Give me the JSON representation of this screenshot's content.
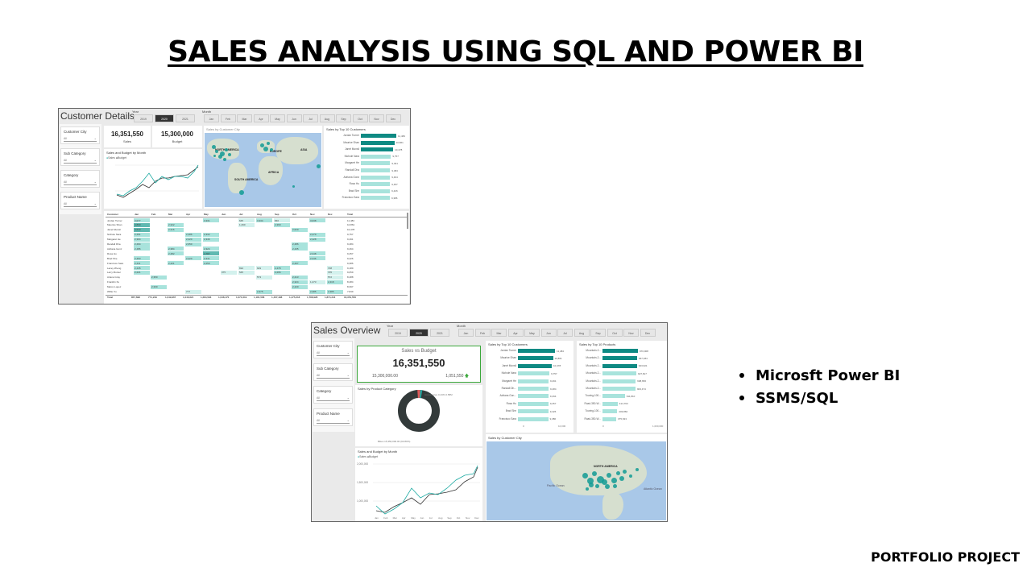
{
  "title": "SALES ANALYSIS USING SQL AND POWER BI",
  "bullets": [
    "Microsft Power BI",
    "SSMS/SQL"
  ],
  "footer": "PORTFOLIO PROJECT",
  "colors": {
    "teal_dark": "#0e8a83",
    "teal_light": "#a8e3dc",
    "kpi_border": "#3ca83c",
    "selected": "#333333"
  },
  "customer_details": {
    "title": "Customer Details",
    "year_label": "Year",
    "years": [
      "2019",
      "2020",
      "2021"
    ],
    "selected_year": "2020",
    "month_label": "Month",
    "months": [
      "Jan",
      "Feb",
      "Mar",
      "Apr",
      "May",
      "Jun",
      "Jul",
      "Aug",
      "Sep",
      "Oct",
      "Nov",
      "Dec"
    ],
    "filters": [
      {
        "label": "Customer City",
        "value": "All"
      },
      {
        "label": "Sub Category",
        "value": "All"
      },
      {
        "label": "Category",
        "value": "All"
      },
      {
        "label": "Product Name",
        "value": "All"
      }
    ],
    "kpis": [
      {
        "value": "16,351,550",
        "label": "Sales"
      },
      {
        "value": "15,300,000",
        "label": "Budget"
      }
    ],
    "line_title": "Sales and Budget by Month",
    "legend": [
      "Sales",
      "Budget"
    ],
    "map_title": "Sales by Customer City",
    "map_labels": [
      "NORTH AMERICA",
      "EUROPE",
      "ASIA",
      "AFRICA",
      "SOUTH AMERICA"
    ],
    "top10_title": "Sales by Top 10 Customers",
    "top10": [
      {
        "name": "Jordan Turner",
        "value": "11,484"
      },
      {
        "name": "Maurice Shan",
        "value": "10,861"
      },
      {
        "name": "Janet Munsil",
        "value": "10,478"
      },
      {
        "name": "Nichole Nara",
        "value": "9,757"
      },
      {
        "name": "Margaret He",
        "value": "9,491"
      },
      {
        "name": "Randall Dha",
        "value": "9,484"
      },
      {
        "name": "Adriana Gonz",
        "value": "9,464"
      },
      {
        "name": "Rosa Hu",
        "value": "9,457"
      },
      {
        "name": "Brad She",
        "value": "9,426"
      },
      {
        "name": "Francisco Sara",
        "value": "9,386"
      }
    ],
    "table_header": [
      "Customer",
      "Jan",
      "Feb",
      "Mar",
      "Apr",
      "May",
      "Jun",
      "Jul",
      "Aug",
      "Sep",
      "Oct",
      "Nov",
      "Dec",
      "Total"
    ],
    "table_rows": [
      [
        "Jordan Turner",
        "3,077",
        "",
        "",
        "",
        "3,331",
        "",
        "645",
        "3,334",
        "840",
        "",
        "3,038",
        "",
        "11,484"
      ],
      [
        "Maurice Shan",
        "4,890",
        "",
        "2,322",
        "",
        "",
        "",
        "1,290",
        "",
        "2,360",
        "",
        "",
        "",
        "10,861"
      ],
      [
        "Janet Munsil",
        "4,610",
        "",
        "2,316",
        "",
        "",
        "",
        "",
        "",
        "",
        "2,620",
        "",
        "",
        "10,478"
      ],
      [
        "Nichole Nara",
        "2,461",
        "",
        "",
        "2,486",
        "2,332",
        "",
        "",
        "",
        "",
        "",
        "2,479",
        "",
        "9,757"
      ],
      [
        "Margaret He",
        "2,304",
        "",
        "",
        "2,420",
        "2,346",
        "",
        "",
        "",
        "",
        "",
        "2,428",
        "",
        "9,491"
      ],
      [
        "Randall Dha",
        "2,494",
        "",
        "",
        "2,350",
        "",
        "",
        "",
        "",
        "",
        "2,486",
        "",
        "",
        "9,484"
      ],
      [
        "Adriana Gonz",
        "2,486",
        "",
        "2,384",
        "",
        "2,324",
        "",
        "",
        "",
        "",
        "2,435",
        "",
        "",
        "9,464"
      ],
      [
        "Rosa Hu",
        "",
        "",
        "2,482",
        "",
        "4,787",
        "",
        "",
        "",
        "",
        "",
        "2,348",
        "",
        "9,457"
      ],
      [
        "Brad She",
        "2,463",
        "",
        "",
        "2,420",
        "2,341",
        "",
        "",
        "",
        "",
        "",
        "2,346",
        "",
        "9,426"
      ],
      [
        "Francisco Sara",
        "2,411",
        "",
        "2,421",
        "",
        "2,250",
        "",
        "",
        "",
        "",
        "2,407",
        "",
        "",
        "9,386"
      ],
      [
        "Lacey Zheng",
        "2,445",
        "",
        "",
        "",
        "",
        "",
        "694",
        "649",
        "2,478",
        "",
        "",
        "708",
        "9,189"
      ],
      [
        "Larry Munter",
        "2,221",
        "",
        "",
        "",
        "",
        "375",
        "545",
        "",
        "2,266",
        "",
        "",
        "705",
        "9,059"
      ],
      [
        "Ariana Gray",
        "",
        "2,350",
        "",
        "",
        "",
        "",
        "",
        "573",
        "",
        "2,413",
        "",
        "572",
        "8,488"
      ],
      [
        "Franklin Xu",
        "",
        "",
        "",
        "",
        "",
        "",
        "",
        "",
        "",
        "2,324",
        "1,273",
        "2,418",
        "8,484"
      ],
      [
        "Marco Lopez",
        "",
        "2,330",
        "",
        "",
        "",
        "",
        "",
        "",
        "",
        "2,420",
        "",
        "",
        "8,397"
      ],
      [
        "Willie Xu",
        "",
        "",
        "",
        "777",
        "",
        "",
        "",
        "2,375",
        "",
        "",
        "2,385",
        "2,385",
        "7,849"
      ]
    ],
    "table_total": [
      "Total",
      "857,698",
      "771,249",
      "1,049,967",
      "1,046,621",
      "1,284,593",
      "1,048,170",
      "1,071,619",
      "1,181,568",
      "1,467,498",
      "1,475,218",
      "1,788,928",
      "1,874,344",
      "16,351,550"
    ]
  },
  "sales_overview": {
    "title": "Sales Overview",
    "year_label": "Year",
    "years": [
      "2019",
      "2020",
      "2021"
    ],
    "selected_year": "2020",
    "month_label": "Month",
    "months": [
      "Jan",
      "Feb",
      "Mar",
      "Apr",
      "May",
      "Jun",
      "Jul",
      "Aug",
      "Sep",
      "Oct",
      "Nov",
      "Dec"
    ],
    "filters": [
      {
        "label": "Customer City",
        "value": "All"
      },
      {
        "label": "Sub Category",
        "value": "All"
      },
      {
        "label": "Category",
        "value": "All"
      },
      {
        "label": "Product Name",
        "value": "All"
      }
    ],
    "kpi_title": "Sales vs Budget",
    "kpi_value": "16,351,550",
    "kpi_budget": "15,300,000.00",
    "kpi_diff": "1,051,550",
    "donut_title": "Sales by Product Category",
    "donut_top_label": "Accessories 0.43% 0.58M",
    "donut_bottom_label": "Bikes 15,350,000.00 (93.80%)",
    "line_title": "Sales and Budget by Month",
    "legend": [
      "Sales",
      "Budget"
    ],
    "line_yticks": [
      "2,000,000",
      "1,500,000",
      "1,000,000"
    ],
    "line_xticks": [
      "Jan",
      "Feb",
      "Mar",
      "Apr",
      "May",
      "Jun",
      "Jul",
      "Aug",
      "Sep",
      "Oct",
      "Nov",
      "Dec"
    ],
    "top_customers_title": "Sales by Top 10 Customers",
    "top_customers": [
      {
        "name": "Jordan Turner",
        "value": "11,484"
      },
      {
        "name": "Maurice Shan",
        "value": "10,861"
      },
      {
        "name": "Janet Munsil",
        "value": "10,478"
      },
      {
        "name": "Nichole Nara",
        "value": "9,757"
      },
      {
        "name": "Margaret He",
        "value": "9,491"
      },
      {
        "name": "Randall Dh...",
        "value": "9,484"
      },
      {
        "name": "Adriana Gon...",
        "value": "9,464"
      },
      {
        "name": "Rosa Hu",
        "value": "9,457"
      },
      {
        "name": "Brad She",
        "value": "9,426"
      },
      {
        "name": "Francisco Sara",
        "value": "9,386"
      }
    ],
    "top_customers_axis": [
      "0",
      "10,000"
    ],
    "top_products_title": "Sales by Top 10 Products",
    "top_products": [
      {
        "name": "Mountain-2...",
        "value": "970,908"
      },
      {
        "name": "Mountain-2...",
        "value": "947,484"
      },
      {
        "name": "Mountain-2...",
        "value": "943,621"
      },
      {
        "name": "Mountain-2...",
        "value": "927,817"
      },
      {
        "name": "Mountain-2...",
        "value": "908,656"
      },
      {
        "name": "Mountain-2...",
        "value": "903,474"
      },
      {
        "name": "Touring-100...",
        "value": "611,810"
      },
      {
        "name": "Road-350-W...",
        "value": "414,763"
      },
      {
        "name": "Touring-100...",
        "value": "403,860"
      },
      {
        "name": "Road-350-W...",
        "value": "375,633"
      }
    ],
    "top_products_axis": [
      "0",
      "1,000,000"
    ],
    "map_title": "Sales by Customer City",
    "map_labels": [
      "NORTH AMERICA",
      "Pacific Ocean",
      "Atlantic Ocean"
    ]
  }
}
